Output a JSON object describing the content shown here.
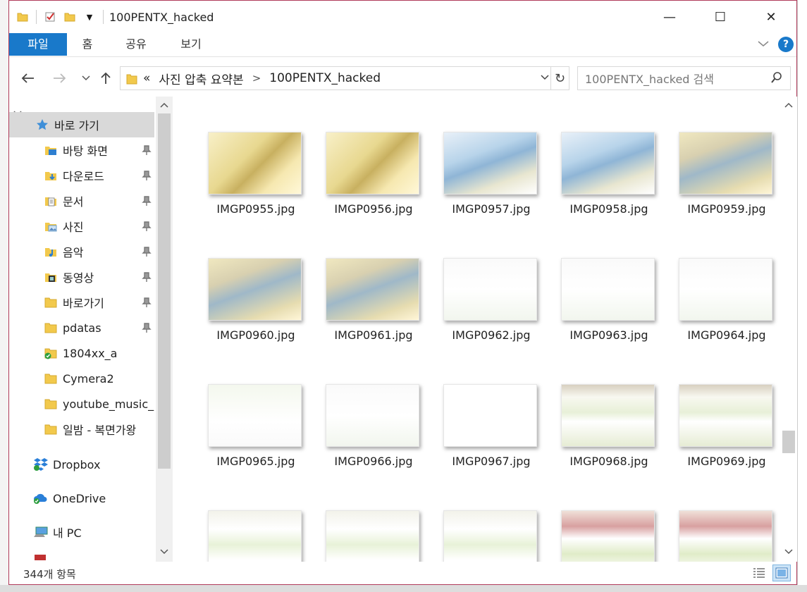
{
  "window": {
    "title": "100PENTX_hacked",
    "controls": {
      "minimize": "—",
      "maximize": "☐",
      "close": "✕"
    }
  },
  "ribbon": {
    "tabs": [
      {
        "label": "파일",
        "active": true
      },
      {
        "label": "홈"
      },
      {
        "label": "공유"
      },
      {
        "label": "보기"
      }
    ],
    "help": "?"
  },
  "address": {
    "overflow": "«",
    "crumbs": [
      "사진 압축 요약본",
      "100PENTX_hacked"
    ],
    "separator": ">",
    "search_placeholder": "100PENTX_hacked 검색"
  },
  "navpane": {
    "quick_access_label": "바로 가기",
    "pinned": [
      {
        "label": "바탕 화면",
        "icon": "desktop-icon"
      },
      {
        "label": "다운로드",
        "icon": "download-folder-icon"
      },
      {
        "label": "문서",
        "icon": "documents-icon"
      },
      {
        "label": "사진",
        "icon": "pictures-icon"
      },
      {
        "label": "음악",
        "icon": "music-icon"
      },
      {
        "label": "동영상",
        "icon": "videos-icon"
      },
      {
        "label": "바로가기",
        "icon": "folder-icon"
      },
      {
        "label": "pdatas",
        "icon": "folder-icon"
      }
    ],
    "recent": [
      {
        "label": "1804xx_a",
        "icon": "synced-folder-icon"
      },
      {
        "label": "Cymera2",
        "icon": "folder-icon"
      },
      {
        "label": "youtube_music_",
        "icon": "folder-icon"
      },
      {
        "label": "일밤 - 복면가왕",
        "icon": "folder-icon"
      }
    ],
    "roots": [
      {
        "label": "Dropbox",
        "icon": "dropbox-icon"
      },
      {
        "label": "OneDrive",
        "icon": "onedrive-icon"
      },
      {
        "label": "내 PC",
        "icon": "pc-icon"
      }
    ]
  },
  "files": [
    {
      "name": "IMGP0955.jpg",
      "style": "warm-people"
    },
    {
      "name": "IMGP0956.jpg",
      "style": "warm-people"
    },
    {
      "name": "IMGP0957.jpg",
      "style": "ceiling"
    },
    {
      "name": "IMGP0958.jpg",
      "style": "ceiling"
    },
    {
      "name": "IMGP0959.jpg",
      "style": "ceiling-warm"
    },
    {
      "name": "IMGP0960.jpg",
      "style": "ceiling-warm"
    },
    {
      "name": "IMGP0961.jpg",
      "style": "ceiling-warm"
    },
    {
      "name": "IMGP0962.jpg",
      "style": "washed"
    },
    {
      "name": "IMGP0963.jpg",
      "style": "washed"
    },
    {
      "name": "IMGP0964.jpg",
      "style": "washed"
    },
    {
      "name": "IMGP0965.jpg",
      "style": "washed-green"
    },
    {
      "name": "IMGP0966.jpg",
      "style": "washed"
    },
    {
      "name": "IMGP0967.jpg",
      "style": "blank"
    },
    {
      "name": "IMGP0968.jpg",
      "style": "shelf"
    },
    {
      "name": "IMGP0969.jpg",
      "style": "shelf"
    },
    {
      "name": "",
      "style": "shelf-light"
    },
    {
      "name": "",
      "style": "shelf-light"
    },
    {
      "name": "",
      "style": "shelf-light"
    },
    {
      "name": "",
      "style": "shelf-red"
    },
    {
      "name": "",
      "style": "shelf-red"
    }
  ],
  "status": {
    "count": "344개 항목"
  },
  "colors": {
    "accent": "#1979ca",
    "selected": "#d9d9d9"
  }
}
